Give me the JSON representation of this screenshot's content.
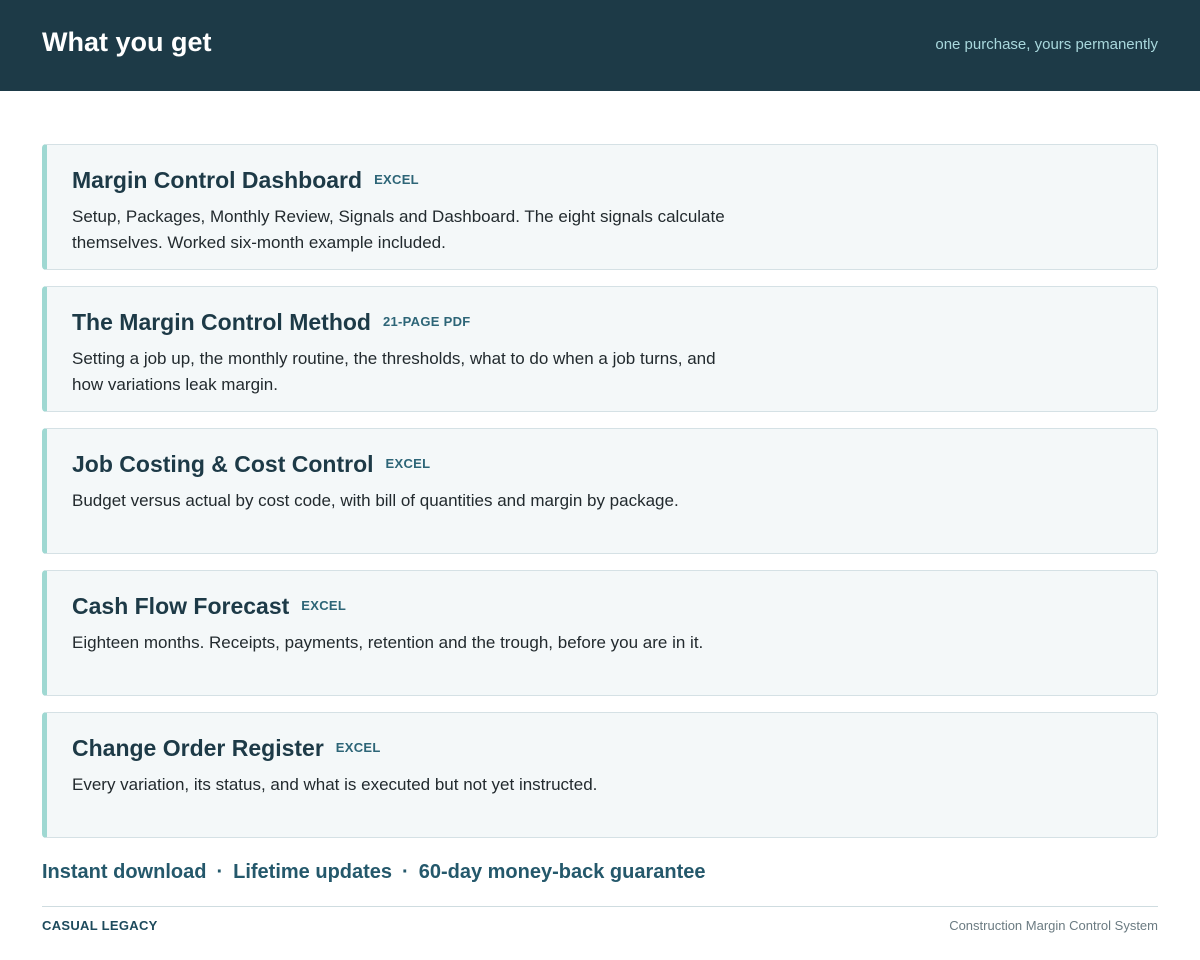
{
  "header": {
    "title": "What you get",
    "tagline": "one purchase, yours permanently"
  },
  "items": [
    {
      "title": "Margin Control Dashboard",
      "badge": "EXCEL",
      "description": "Setup, Packages, Monthly Review, Signals and Dashboard. The eight signals calculate themselves. Worked six-month example included."
    },
    {
      "title": "The Margin Control Method",
      "badge": "21-PAGE PDF",
      "description": "Setting a job up, the monthly routine, the thresholds, what to do when a job turns, and how variations leak margin."
    },
    {
      "title": "Job Costing & Cost Control",
      "badge": "EXCEL",
      "description": "Budget versus actual by cost code, with bill of quantities and margin by package."
    },
    {
      "title": "Cash Flow Forecast",
      "badge": "EXCEL",
      "description": "Eighteen months. Receipts, payments, retention and the trough, before you are in it."
    },
    {
      "title": "Change Order Register",
      "badge": "EXCEL",
      "description": "Every variation, its status, and what is executed but not yet instructed."
    }
  ],
  "benefits": [
    "Instant download",
    "Lifetime updates",
    "60-day money-back guarantee"
  ],
  "separator": "·",
  "footer": {
    "brand": "CASUAL LEGACY",
    "product": "Construction Margin Control System"
  },
  "colors": {
    "header_bg": "#1d3a47",
    "accent_bar": "#9fd8d2",
    "card_bg": "#f4f8f9"
  }
}
